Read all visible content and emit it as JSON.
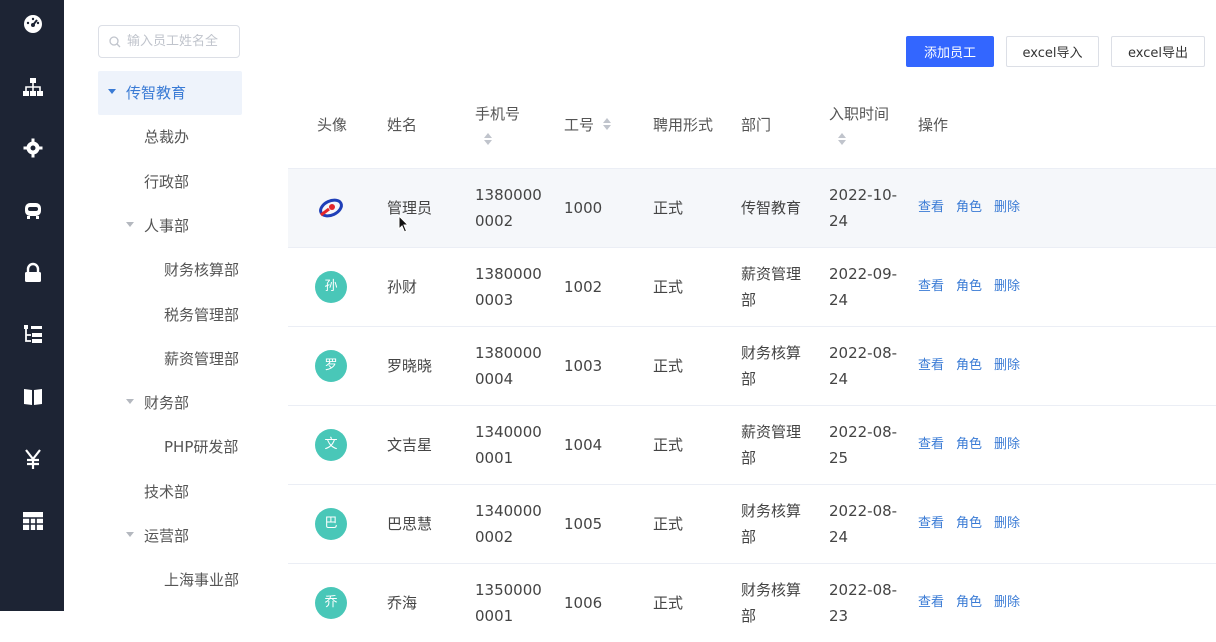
{
  "theme": {
    "sidebar_bg": "#1d2434",
    "accent": "#3366ff",
    "link": "#3a7bd5",
    "avatar_bg": "#49c7b8"
  },
  "sidebar": {
    "icons": [
      "dashboard-icon",
      "org-chart-icon",
      "settings-gear-icon",
      "robot-icon",
      "lock-icon",
      "tree-list-icon",
      "book-icon",
      "yuan-icon",
      "table-grid-icon"
    ]
  },
  "tree": {
    "search_placeholder": "输入员工姓名全",
    "nodes": [
      {
        "label": "传智教育",
        "level": 0,
        "expanded": true,
        "selected": true
      },
      {
        "label": "总裁办",
        "level": 1
      },
      {
        "label": "行政部",
        "level": 1
      },
      {
        "label": "人事部",
        "level": 1,
        "expanded": true
      },
      {
        "label": "财务核算部",
        "level": 2
      },
      {
        "label": "税务管理部",
        "level": 2
      },
      {
        "label": "薪资管理部",
        "level": 2
      },
      {
        "label": "财务部",
        "level": 1,
        "expanded": true
      },
      {
        "label": "PHP研发部",
        "level": 2
      },
      {
        "label": "技术部",
        "level": 1
      },
      {
        "label": "运营部",
        "level": 1,
        "expanded": true
      },
      {
        "label": "上海事业部",
        "level": 2
      }
    ]
  },
  "toolbar": {
    "add_label": "添加员工",
    "import_label": "excel导入",
    "export_label": "excel导出"
  },
  "table": {
    "headers": {
      "avatar": "头像",
      "name": "姓名",
      "phone": "手机号",
      "job_number": "工号",
      "employment": "聘用形式",
      "department": "部门",
      "hire_date": "入职时间",
      "actions": "操作"
    },
    "actions": {
      "view": "查看",
      "role": "角色",
      "delete": "删除"
    },
    "rows": [
      {
        "avatar": "",
        "logo": true,
        "name": "管理员",
        "phone_a": "1380000",
        "phone_b": "0002",
        "job_number": "1000",
        "employment": "正式",
        "dept_a": "传智教育",
        "dept_b": "",
        "date_a": "2022-10-",
        "date_b": "24"
      },
      {
        "avatar": "孙",
        "name": "孙财",
        "phone_a": "1380000",
        "phone_b": "0003",
        "job_number": "1002",
        "employment": "正式",
        "dept_a": "薪资管理",
        "dept_b": "部",
        "date_a": "2022-09-",
        "date_b": "24"
      },
      {
        "avatar": "罗",
        "name": "罗晓晓",
        "phone_a": "1380000",
        "phone_b": "0004",
        "job_number": "1003",
        "employment": "正式",
        "dept_a": "财务核算",
        "dept_b": "部",
        "date_a": "2022-08-",
        "date_b": "24"
      },
      {
        "avatar": "文",
        "name": "文吉星",
        "phone_a": "1340000",
        "phone_b": "0001",
        "job_number": "1004",
        "employment": "正式",
        "dept_a": "薪资管理",
        "dept_b": "部",
        "date_a": "2022-08-",
        "date_b": "25"
      },
      {
        "avatar": "巴",
        "name": "巴思慧",
        "phone_a": "1340000",
        "phone_b": "0002",
        "job_number": "1005",
        "employment": "正式",
        "dept_a": "财务核算",
        "dept_b": "部",
        "date_a": "2022-08-",
        "date_b": "24"
      },
      {
        "avatar": "乔",
        "name": "乔海",
        "phone_a": "1350000",
        "phone_b": "0001",
        "job_number": "1006",
        "employment": "正式",
        "dept_a": "财务核算",
        "dept_b": "部",
        "date_a": "2022-08-",
        "date_b": "23"
      }
    ]
  }
}
